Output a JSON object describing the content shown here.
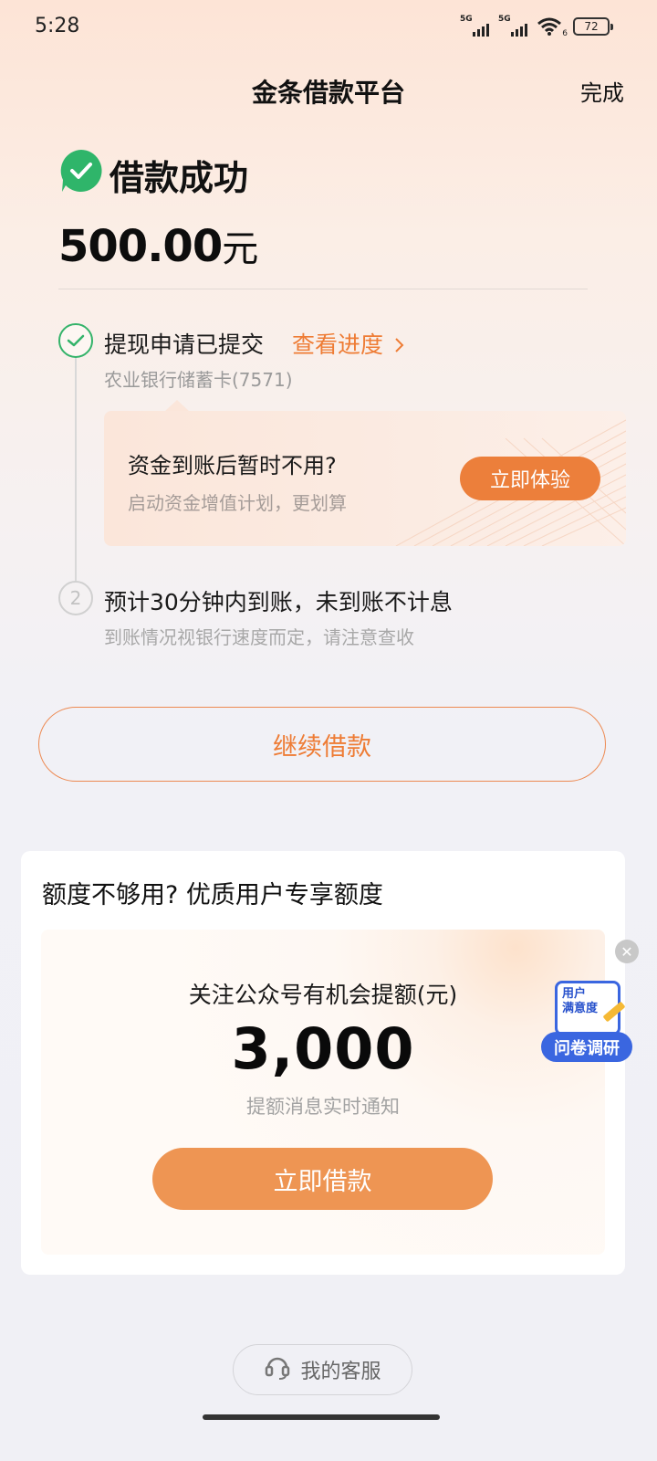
{
  "status_bar": {
    "time": "5:28",
    "signal1_label": "5G",
    "signal2_label": "5G",
    "wifi_sub": "6",
    "battery": "72"
  },
  "header": {
    "title": "金条借款平台",
    "done": "完成"
  },
  "result": {
    "title": "借款成功",
    "amount": "500.00",
    "amount_unit": "元"
  },
  "steps": [
    {
      "title": "提现申请已提交",
      "link": "查看进度",
      "detail": "农业银行储蓄卡(7571)"
    },
    {
      "number": "2",
      "title": "预计30分钟内到账，未到账不计息",
      "detail": "到账情况视银行速度而定，请注意查收"
    }
  ],
  "promo": {
    "title": "资金到账后暂时不用?",
    "subtitle": "启动资金增值计划，更划算",
    "button": "立即体验"
  },
  "continue_button": "继续借款",
  "quota_card": {
    "title": "额度不够用? 优质用户专享额度",
    "subtitle": "关注公众号有机会提额(元)",
    "amount": "3,000",
    "note": "提额消息实时通知",
    "button": "立即借款"
  },
  "survey": {
    "card_line1": "用户",
    "card_line2": "满意度",
    "label": "问卷调研"
  },
  "service": {
    "label": "我的客服"
  },
  "colors": {
    "accent": "#ee7c35",
    "success": "#34b36a",
    "survey": "#3a66e0"
  }
}
